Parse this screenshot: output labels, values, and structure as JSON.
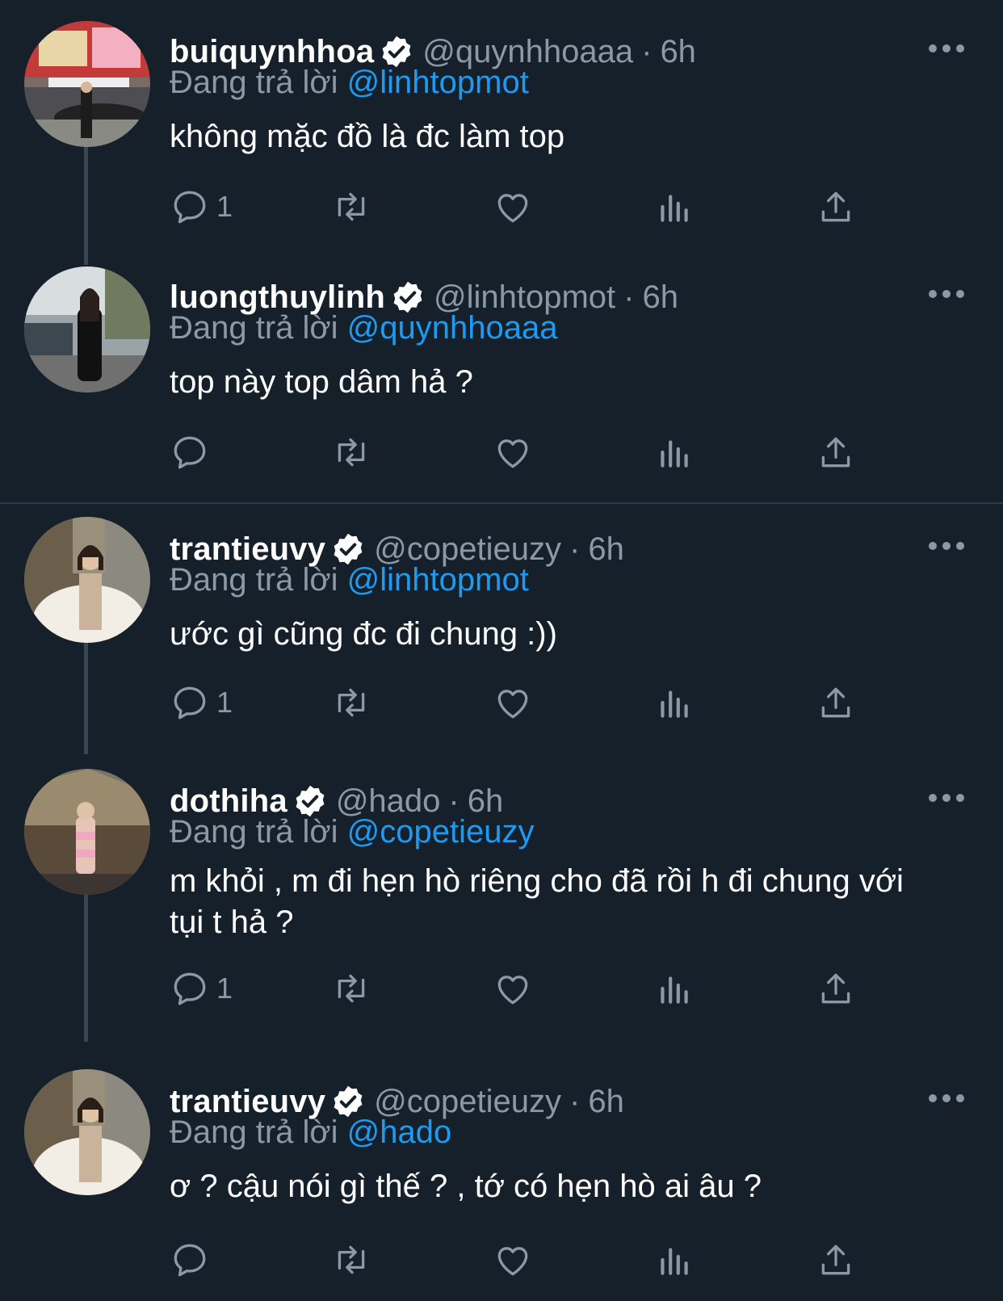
{
  "tweets": [
    {
      "display_name": "buiquynhhoa",
      "handle": "@quynhhoaaa",
      "time": "6h",
      "reply_prefix": "Đang trả lời",
      "reply_to": "@linhtopmot",
      "text": "không mặc đồ là đc làm top",
      "reply_count": "1",
      "avatar_icon": "avatar-street-photo"
    },
    {
      "display_name": "luongthuylinh",
      "handle": "@linhtopmot",
      "time": "6h",
      "reply_prefix": "Đang trả lời",
      "reply_to": "@quynhhoaaa",
      "text": "top này top dâm hả ?",
      "reply_count": "",
      "avatar_icon": "avatar-street-photo"
    },
    {
      "display_name": "trantieuvy",
      "handle": "@copetieuzy",
      "time": "6h",
      "reply_prefix": "Đang trả lời",
      "reply_to": "@linhtopmot",
      "text": "ước gì cũng đc đi chung :))",
      "reply_count": "1",
      "avatar_icon": "avatar-fur-coat-photo"
    },
    {
      "display_name": "dothiha",
      "handle": "@hado",
      "time": "6h",
      "reply_prefix": "Đang trả lời",
      "reply_to": "@copetieuzy",
      "text": "m khỏi , m đi hẹn hò riêng cho đã rồi h đi chung với tụi t hả ?",
      "reply_count": "1",
      "avatar_icon": "avatar-hut-photo"
    },
    {
      "display_name": "trantieuvy",
      "handle": "@copetieuzy",
      "time": "6h",
      "reply_prefix": "Đang trả lời",
      "reply_to": "@hado",
      "text": "ơ ? cậu nói gì thế ? , tớ có hẹn hò ai âu ?",
      "reply_count": "",
      "avatar_icon": "avatar-fur-coat-photo"
    }
  ],
  "icons": {
    "reply": "reply-icon",
    "retweet": "retweet-icon",
    "like": "heart-icon",
    "views": "views-icon",
    "share": "share-icon",
    "more": "more-icon",
    "verified": "verified-badge-icon"
  },
  "colors": {
    "background": "#16202b",
    "text": "#ffffff",
    "secondary": "#8b98a5",
    "link": "#1d9bf0",
    "divider": "#2f3b47"
  }
}
